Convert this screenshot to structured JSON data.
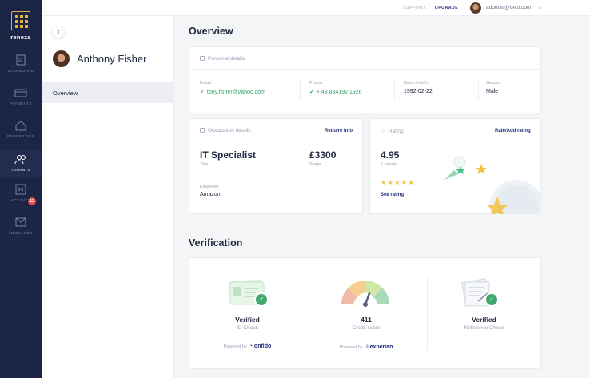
{
  "brand": {
    "logo_text": "reneza",
    "accent": "#e0b43c",
    "sidebar_bg": "#1c2545"
  },
  "sidebar": {
    "items": [
      {
        "label": "Dashboard",
        "icon": "dashboard-icon"
      },
      {
        "label": "Payments",
        "icon": "payments-icon"
      },
      {
        "label": "Properties",
        "icon": "home-icon"
      },
      {
        "label": "Tenants",
        "icon": "users-icon",
        "active": true
      },
      {
        "label": "Activity",
        "icon": "activity-icon",
        "badge": "12"
      },
      {
        "label": "Messages",
        "icon": "mail-icon"
      }
    ]
  },
  "topbar": {
    "support": "SUPPORT",
    "upgrade": "UPGRADE",
    "email": "adomas@bettr.com"
  },
  "profile": {
    "name": "Anthony Fisher",
    "tab": "Overview"
  },
  "overview": {
    "title": "Overview",
    "personal": {
      "header": "Personal details",
      "email_label": "Email:",
      "email": "tony.fisher@yahoo.com",
      "phone_label": "Phone:",
      "phone": "+ 48 834192 1926",
      "dob_label": "Date of birth:",
      "dob": "1992-02-22",
      "gender_label": "Gender:",
      "gender": "Male"
    },
    "occupation": {
      "header": "Occupation details",
      "action": "Require info",
      "title_value": "IT Specialist",
      "title_label": "Title",
      "wage_value": "£3300",
      "wage_label": "Wage",
      "employer_label": "Employer:",
      "employer": "Amazon"
    },
    "rating": {
      "header": "Rating",
      "action": "Rate/Add rating",
      "value": "4.95",
      "count": "5 ratings",
      "stars": 5,
      "link": "See rating"
    }
  },
  "verification": {
    "title": "Verification",
    "items": [
      {
        "status": "Verified",
        "label": "ID Check",
        "powered": "Powered by",
        "provider": "onfido"
      },
      {
        "status": "411",
        "label": "Credit score",
        "powered": "Powered by",
        "provider": "experian"
      },
      {
        "status": "Verified",
        "label": "Reference Check",
        "powered": "",
        "provider": ""
      }
    ]
  }
}
